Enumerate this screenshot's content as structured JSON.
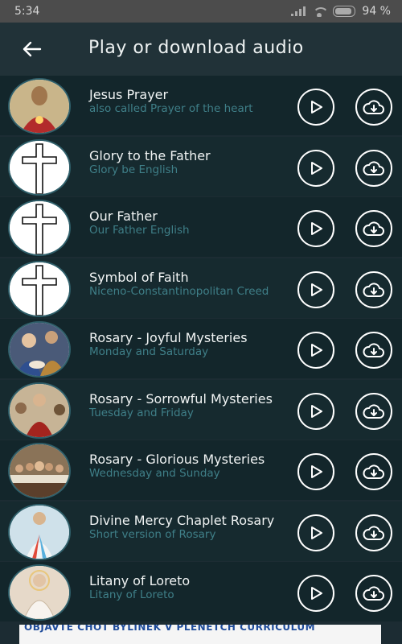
{
  "status_bar": {
    "time": "5:34",
    "battery_percent": "94 %"
  },
  "header": {
    "title": "Play or download audio",
    "back_icon": "arrow-left-icon"
  },
  "items": [
    {
      "title": "Jesus Prayer",
      "subtitle": "also called Prayer of the heart",
      "thumbnail": "jesus-sacred-heart-image"
    },
    {
      "title": "Glory to the Father",
      "subtitle": "Glory be English",
      "thumbnail": "cross-icon"
    },
    {
      "title": "Our Father",
      "subtitle": "Our Father English",
      "thumbnail": "cross-icon"
    },
    {
      "title": "Symbol of Faith",
      "subtitle": "Niceno-Constantinopolitan Creed",
      "thumbnail": "cross-icon"
    },
    {
      "title": "Rosary - Joyful Mysteries",
      "subtitle": "Monday and Saturday",
      "thumbnail": "nativity-image"
    },
    {
      "title": "Rosary - Sorrowful Mysteries",
      "subtitle": "Tuesday and Friday",
      "thumbnail": "crucifixion-image"
    },
    {
      "title": "Rosary - Glorious Mysteries",
      "subtitle": "Wednesday and Sunday",
      "thumbnail": "last-supper-image"
    },
    {
      "title": "Divine Mercy Chaplet Rosary",
      "subtitle": "Short version of Rosary",
      "thumbnail": "divine-mercy-image"
    },
    {
      "title": "Litany of Loreto",
      "subtitle": "Litany of Loreto",
      "thumbnail": "virgin-mary-image"
    }
  ],
  "colors": {
    "background": "#1c2c33",
    "row": "#162a2f",
    "subtitle": "#3f7f88",
    "accent_border": "#2f5f6a"
  },
  "ad_banner": {
    "text": "OBJAVTE CHOT BYLINEK V PLENETCH CURRICULUM"
  }
}
